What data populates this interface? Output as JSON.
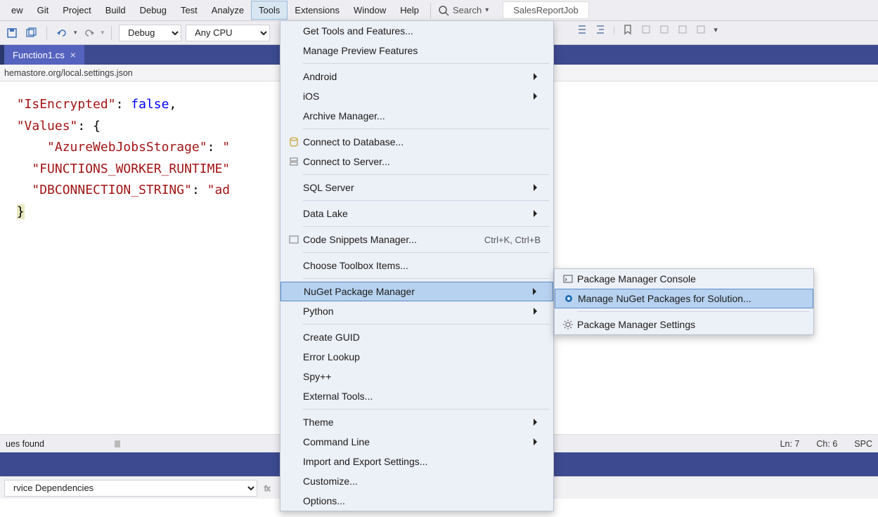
{
  "menubar": {
    "items": [
      "ew",
      "Git",
      "Project",
      "Build",
      "Debug",
      "Test",
      "Analyze",
      "Tools",
      "Extensions",
      "Window",
      "Help"
    ],
    "active_index": 7,
    "search_label": "Search",
    "solution_name": "SalesReportJob"
  },
  "toolbar": {
    "config": "Debug",
    "platform": "Any CPU"
  },
  "tab": {
    "title": "Function1.cs"
  },
  "schemabar": {
    "text": "hemastore.org/local.settings.json"
  },
  "code": {
    "l1_key": "\"IsEncrypted\"",
    "l1_val": "false",
    "l2_key": "\"Values\"",
    "l3_key": "\"AzureWebJobsStorage\"",
    "l3_val": "\"",
    "l4_key": "\"FUNCTIONS_WORKER_RUNTIME\"",
    "l5_key": "\"DBCONNECTION_STRING\"",
    "l5_val": "\"ad"
  },
  "tools_menu": [
    {
      "label": "Get Tools and Features...",
      "icon": ""
    },
    {
      "label": "Manage Preview Features",
      "icon": ""
    },
    {
      "sep": true
    },
    {
      "label": "Android",
      "sub": true
    },
    {
      "label": "iOS",
      "sub": true
    },
    {
      "label": "Archive Manager...",
      "icon": ""
    },
    {
      "sep": true
    },
    {
      "label": "Connect to Database...",
      "icon": "db"
    },
    {
      "label": "Connect to Server...",
      "icon": "server"
    },
    {
      "sep": true
    },
    {
      "label": "SQL Server",
      "sub": true
    },
    {
      "sep": true
    },
    {
      "label": "Data Lake",
      "sub": true
    },
    {
      "sep": true
    },
    {
      "label": "Code Snippets Manager...",
      "icon": "snip",
      "shortcut": "Ctrl+K, Ctrl+B"
    },
    {
      "sep": true
    },
    {
      "label": "Choose Toolbox Items...",
      "icon": ""
    },
    {
      "sep": true
    },
    {
      "label": "NuGet Package Manager",
      "sub": true,
      "highlight": true
    },
    {
      "label": "Python",
      "sub": true
    },
    {
      "sep": true
    },
    {
      "label": "Create GUID"
    },
    {
      "label": "Error Lookup"
    },
    {
      "label": "Spy++"
    },
    {
      "label": "External Tools..."
    },
    {
      "sep": true
    },
    {
      "label": "Theme",
      "sub": true
    },
    {
      "label": "Command Line",
      "sub": true
    },
    {
      "label": "Import and Export Settings..."
    },
    {
      "label": "Customize..."
    },
    {
      "label": "Options..."
    }
  ],
  "nuget_submenu": [
    {
      "label": "Package Manager Console",
      "icon": "console"
    },
    {
      "label": "Manage NuGet Packages for Solution...",
      "icon": "package",
      "highlight": true
    },
    {
      "sep": true
    },
    {
      "label": "Package Manager Settings",
      "icon": "gear"
    }
  ],
  "status": {
    "issues": "ues found",
    "ln": "Ln: 7",
    "ch": "Ch: 6",
    "mode": "SPC"
  },
  "lowerbar": {
    "combo": "rvice Dependencies"
  }
}
